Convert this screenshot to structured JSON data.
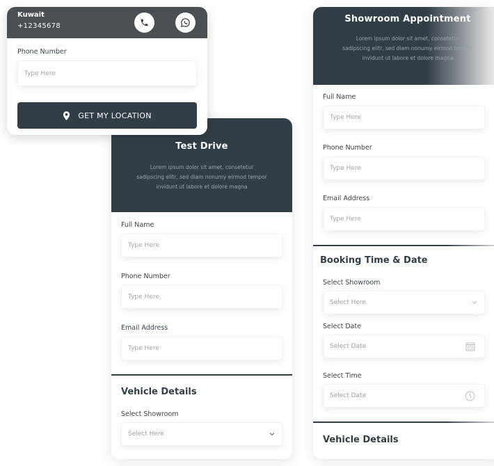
{
  "location_card": {
    "country": "Kuwait",
    "phone": "+12345678",
    "call_icon": "phone-icon",
    "whatsapp_icon": "whatsapp-icon",
    "phone_label": "Phone Number",
    "phone_placeholder": "Type Here",
    "location_button": "GET MY LOCATION",
    "location_icon": "map-pin-icon"
  },
  "test_drive": {
    "title": "Test Drive",
    "description": "Lorem ipsum dolor sit amet, consetetur sadipscing elitr, sed diam nonumy eirmod tempor invidunt ut labore et dolore magna",
    "fields": [
      {
        "label": "Full Name",
        "placeholder": "Type Here"
      },
      {
        "label": "Phone Number",
        "placeholder": "Type Here"
      },
      {
        "label": "Email Address",
        "placeholder": "Type Here"
      }
    ],
    "vehicle_section": {
      "title": "Vehicle Details",
      "showroom_label": "Select Showroom",
      "showroom_value": "Select Here"
    }
  },
  "showroom_appointment": {
    "title": "Showroom Appointment",
    "description": "Lorem ipsum dolor sit amet, consetetur sadipscing elitr, sed diam nonumy eirmod tempor invidunt ut labore et dolore magna",
    "fields": [
      {
        "label": "Full Name",
        "placeholder": "Type Here"
      },
      {
        "label": "Phone Number",
        "placeholder": "Type Here"
      },
      {
        "label": "Email Address",
        "placeholder": "Type Here"
      }
    ],
    "booking_section": {
      "title": "Booking Time & Date",
      "showroom_label": "Select Showroom",
      "showroom_value": "Select Here",
      "date_label": "Select Date",
      "date_placeholder": "Select Date",
      "time_label": "Select Time",
      "time_placeholder": "Select Date"
    },
    "vehicle_section": {
      "title": "Vehicle Details"
    }
  }
}
